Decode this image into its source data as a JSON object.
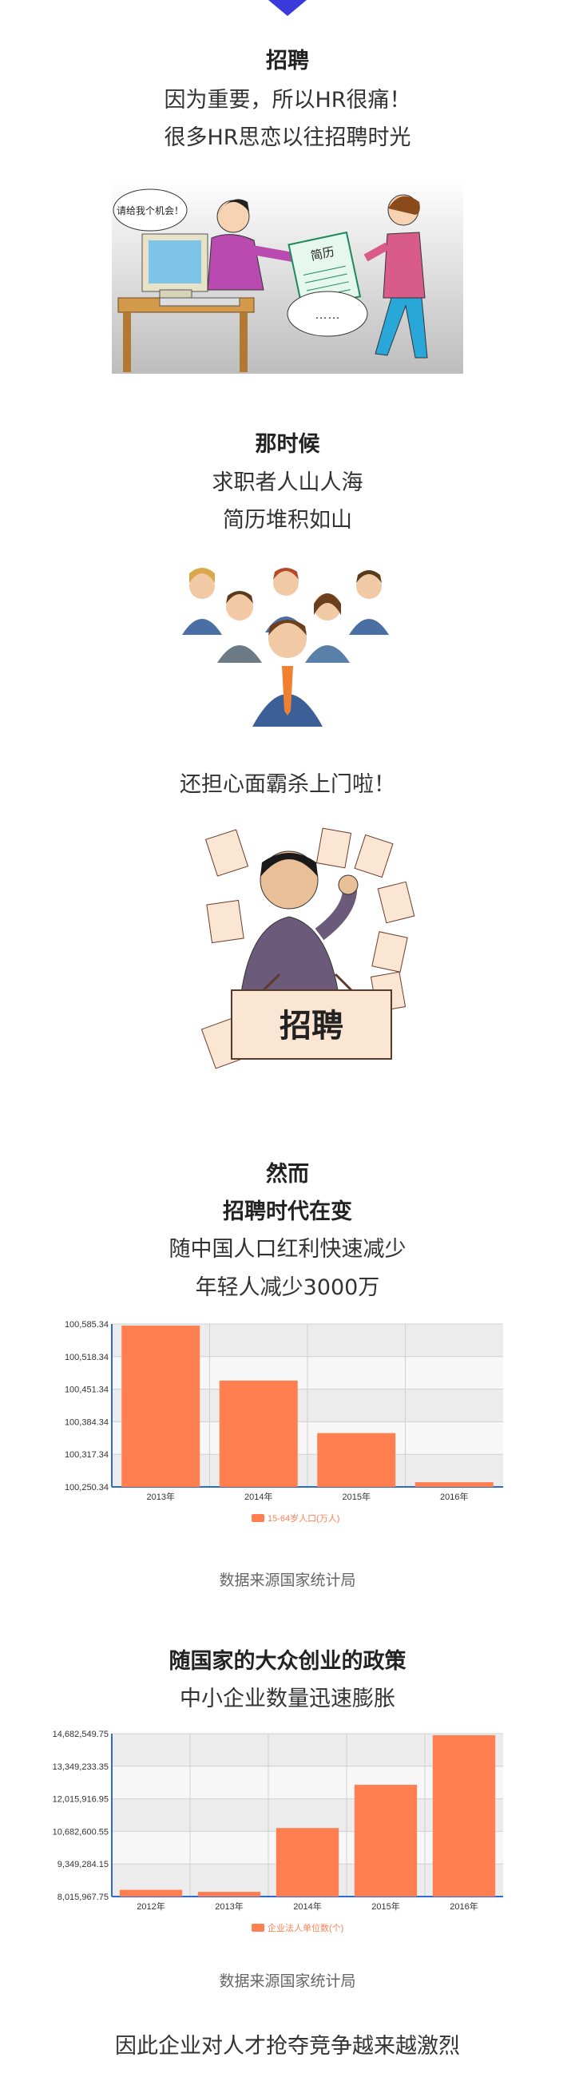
{
  "colors": {
    "accent": "#3a3adb",
    "bar": "#ff7f50",
    "text": "#333333",
    "muted": "#666666"
  },
  "sec1": {
    "title": "招聘",
    "line1": "因为重要，所以HR很痛！",
    "line2": "很多HR思恋以往招聘时光"
  },
  "cartoon1": {
    "bubble_left": "请给我个机会！",
    "paper_label": "简历",
    "bubble_right": "……"
  },
  "sec2": {
    "title": "那时候",
    "line1": "求职者人山人海",
    "line2": "简历堆积如山"
  },
  "sec3": {
    "line1": "还担心面霸杀上门啦！"
  },
  "cartoon3": {
    "sign": "招聘",
    "paper_label": "招聘"
  },
  "sec4": {
    "title1": "然而",
    "title2": "招聘时代在变",
    "line1": "随中国人口红利快速减少",
    "line2": "年轻人减少3000万"
  },
  "source_label": "数据来源国家统计局",
  "sec5": {
    "title": "随国家的大众创业的政策",
    "line1": "中小企业数量迅速膨胀"
  },
  "footer": {
    "text": "因此企业对人才抢夺竞争越来越激烈"
  },
  "chart_data": [
    {
      "type": "bar",
      "categories": [
        "2013年",
        "2014年",
        "2015年",
        "2016年"
      ],
      "series": [
        {
          "name": "15-64岁人口(万人)",
          "values": [
            100582,
            100469,
            100361,
            100260
          ]
        }
      ],
      "yticks": [
        "100,585.34",
        "100,518.34",
        "100,451.34",
        "100,384.34",
        "100,317.34",
        "100,250.34"
      ],
      "ylim": [
        100250.34,
        100585.34
      ],
      "grid": true,
      "legend": "bottom"
    },
    {
      "type": "bar",
      "categories": [
        "2012年",
        "2013年",
        "2014年",
        "2015年",
        "2016年"
      ],
      "series": [
        {
          "name": "企业法人单位数(个)",
          "values": [
            8290000,
            8210000,
            10820000,
            12590000,
            14620000
          ]
        }
      ],
      "yticks": [
        "14,682,549.75",
        "13,349,233.35",
        "12,015,916.95",
        "10,682,600.55",
        "9,349,284.15",
        "8,015,967.75"
      ],
      "ylim": [
        8015967.75,
        14682549.75
      ],
      "grid": true,
      "legend": "bottom"
    }
  ]
}
